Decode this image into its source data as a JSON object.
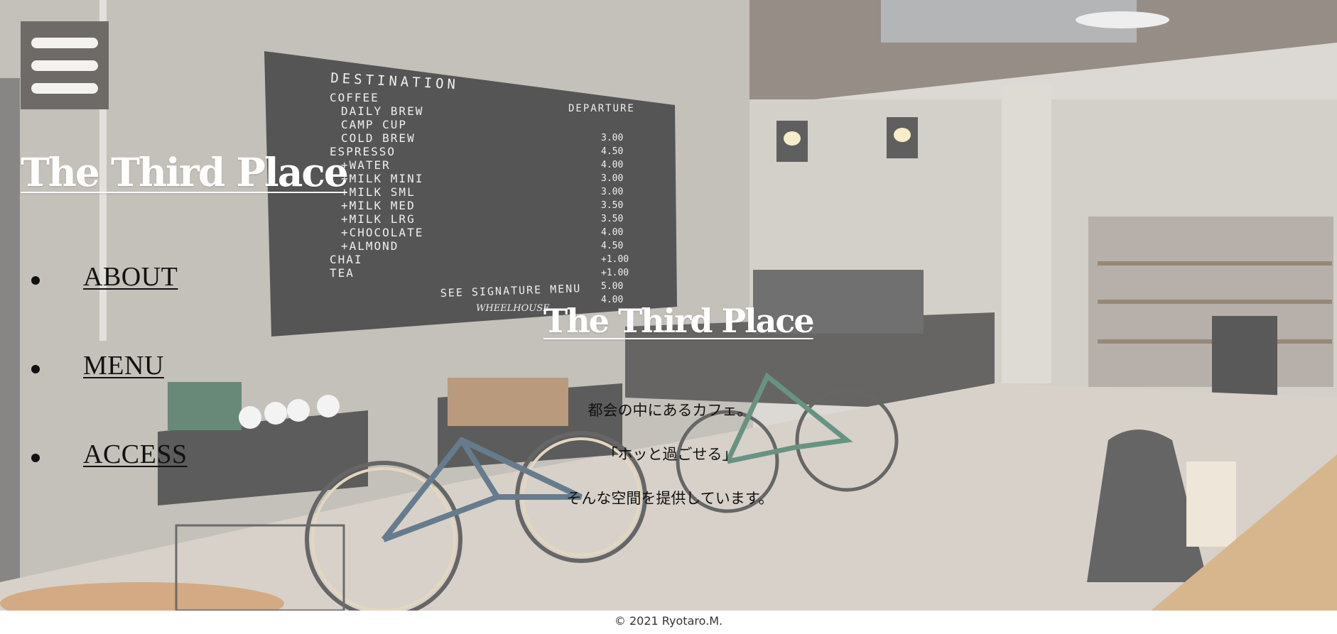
{
  "header": {
    "menu_icon": "hamburger-icon",
    "brand": "The Third Place"
  },
  "nav": {
    "items": [
      {
        "label": "ABOUT"
      },
      {
        "label": "MENU"
      },
      {
        "label": "ACCESS"
      }
    ]
  },
  "hero": {
    "title": "The Third Place",
    "lines": [
      "都会の中にあるカフェ。",
      "「ホッと過ごせる」",
      "そんな空間を提供しています。"
    ]
  },
  "board": {
    "heading": "DESTINATION",
    "heading2": "DEPARTURE",
    "items": [
      {
        "name": "COFFEE",
        "price": ""
      },
      {
        "name": "DAILY BREW",
        "price": "3.00"
      },
      {
        "name": "CAMP CUP",
        "price": "4.50"
      },
      {
        "name": "COLD BREW",
        "price": "4.00"
      },
      {
        "name": "ESPRESSO",
        "price": "3.00"
      },
      {
        "name": "+WATER",
        "price": "3.00"
      },
      {
        "name": "+MILK MINI",
        "price": "3.50"
      },
      {
        "name": "+MILK SML",
        "price": "3.50"
      },
      {
        "name": "+MILK MED",
        "price": "4.00"
      },
      {
        "name": "+MILK LRG",
        "price": "4.50"
      },
      {
        "name": "+CHOCOLATE",
        "price": "+1.00"
      },
      {
        "name": "+ALMOND",
        "price": "+1.00"
      },
      {
        "name": "CHAI",
        "price": "5.00"
      },
      {
        "name": "TEA",
        "price": "4.00"
      }
    ],
    "footer": "SEE SIGNATURE MENU",
    "brand": "WHEELHOUSE"
  },
  "footer": {
    "copyright": "© 2021 Ryotaro.M."
  },
  "colors": {
    "menu_button_bg": "#6d6a68",
    "title_text": "#ffffff",
    "body_text": "#111111"
  }
}
